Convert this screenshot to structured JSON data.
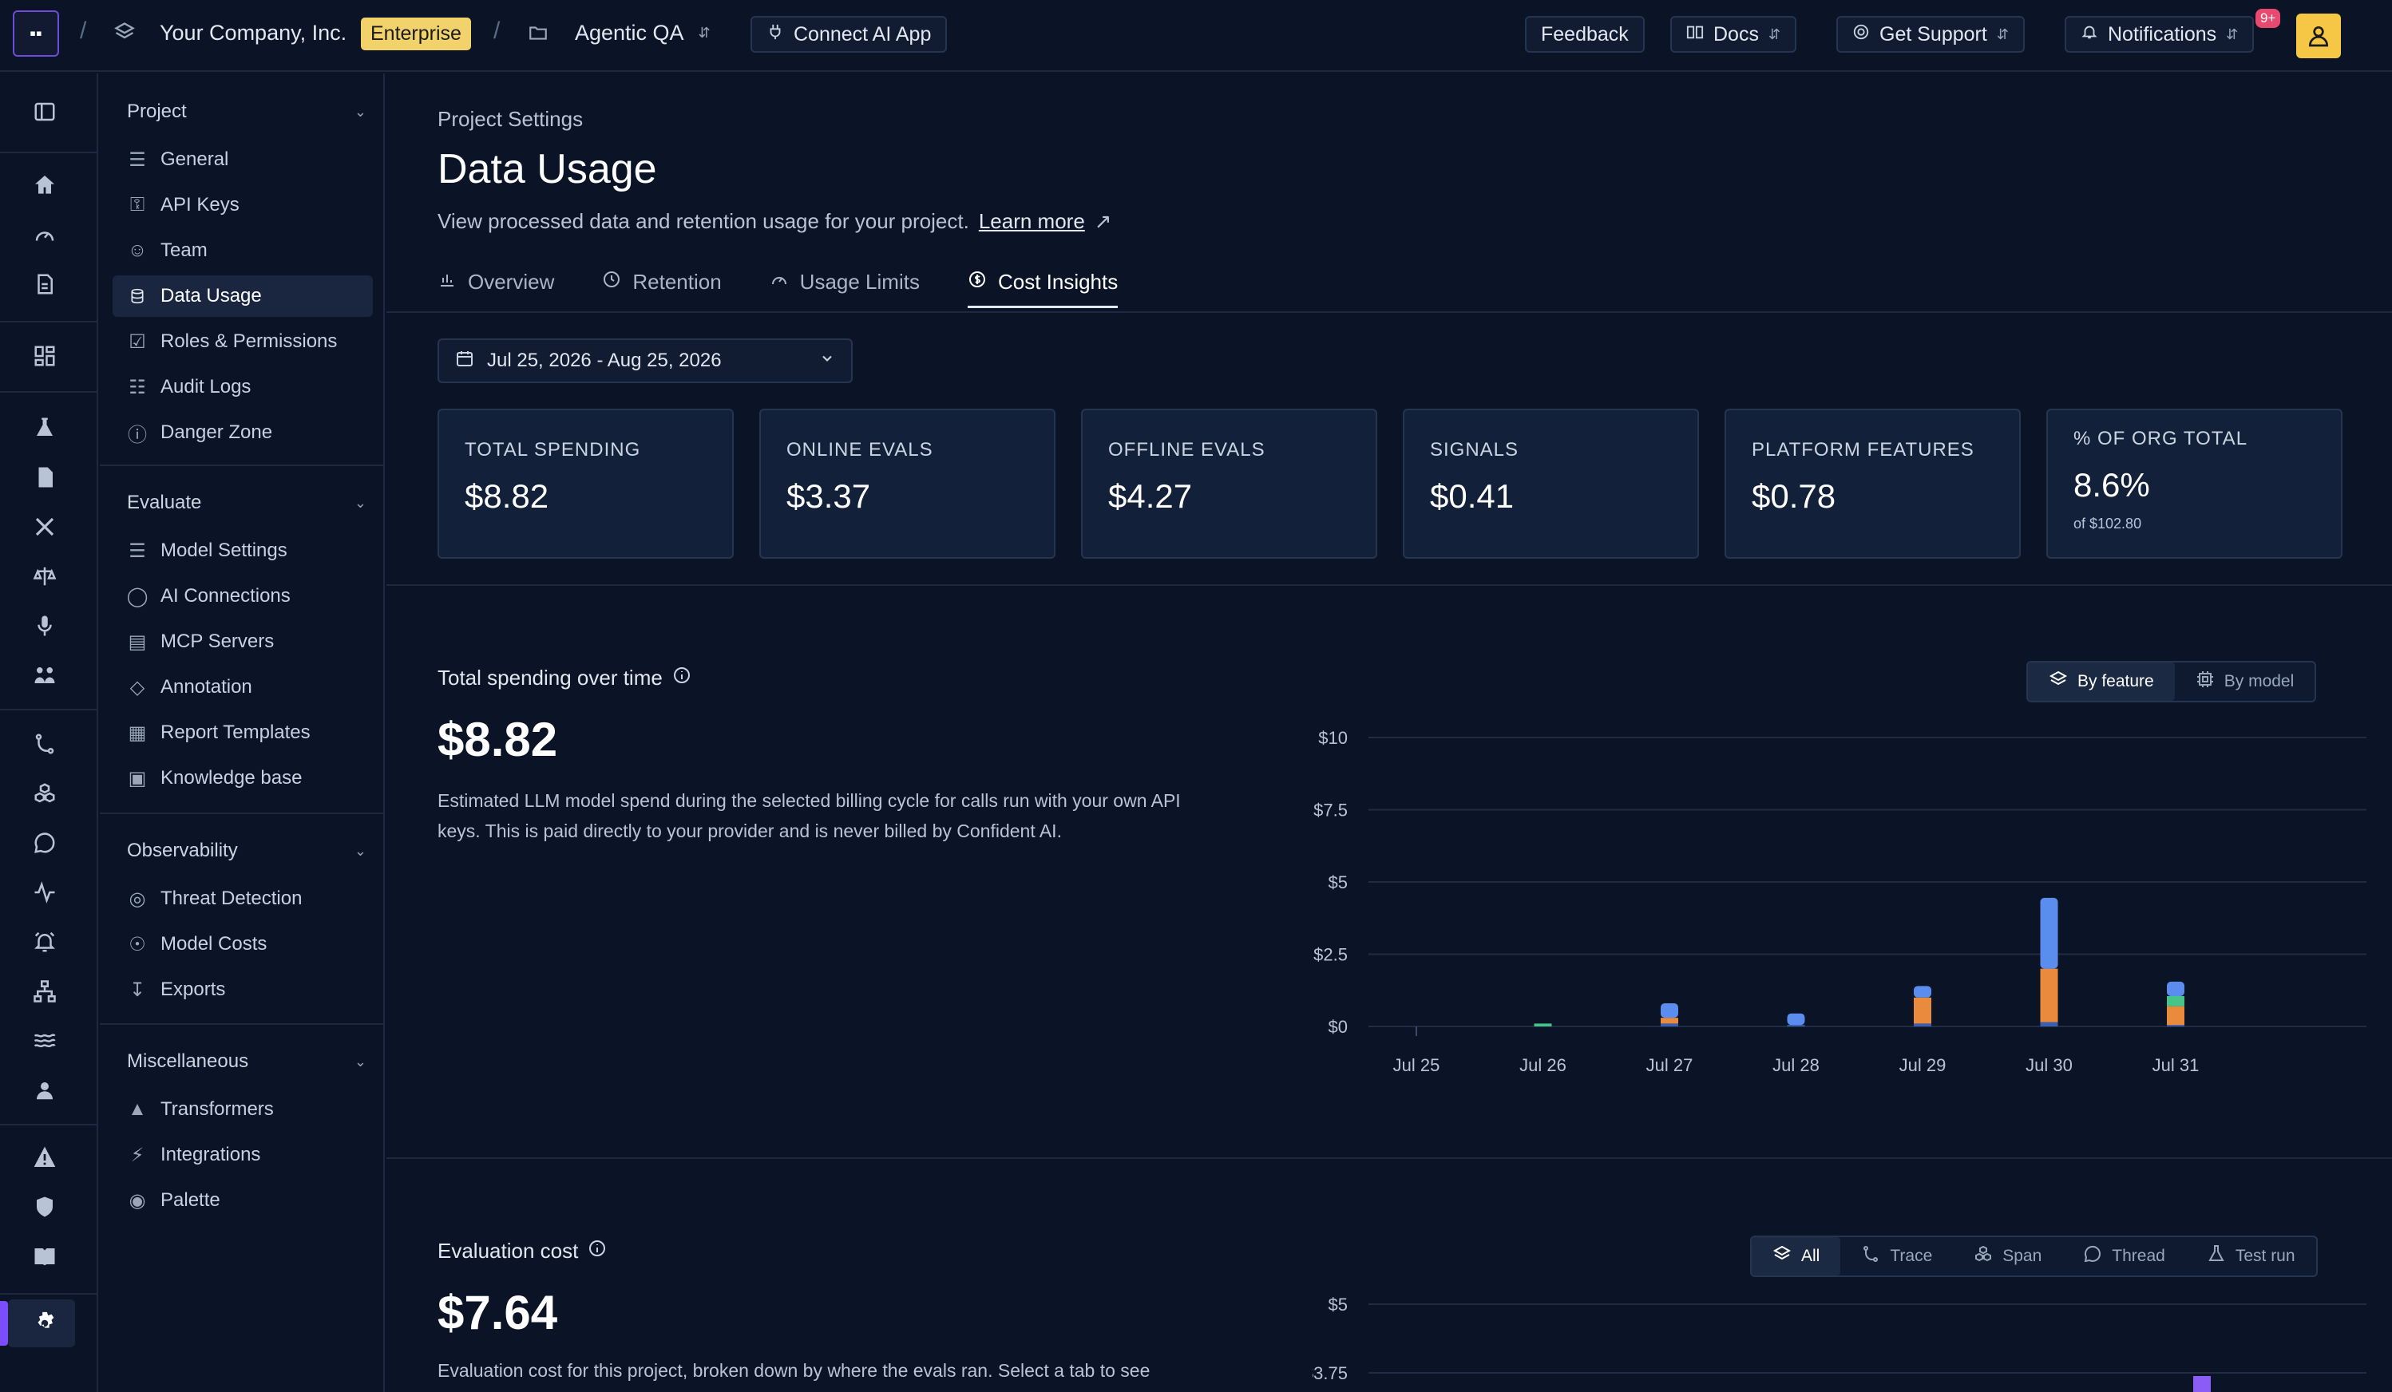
{
  "topbar": {
    "logo": "▪▪",
    "company": "Your Company, Inc.",
    "plan_badge": "Enterprise",
    "project": "Agentic QA",
    "connect_label": "Connect AI App",
    "feedback_label": "Feedback",
    "docs_label": "Docs",
    "support_label": "Get Support",
    "notifications_label": "Notifications",
    "notifications_badge": "9+"
  },
  "sidebar": {
    "groups": [
      {
        "title": "Project",
        "items": [
          "General",
          "API Keys",
          "Team",
          "Data Usage",
          "Roles & Permissions",
          "Audit Logs",
          "Danger Zone"
        ]
      },
      {
        "title": "Evaluate",
        "items": [
          "Model Settings",
          "AI Connections",
          "MCP Servers",
          "Annotation",
          "Report Templates",
          "Knowledge base"
        ]
      },
      {
        "title": "Observability",
        "items": [
          "Threat Detection",
          "Model Costs",
          "Exports"
        ]
      },
      {
        "title": "Miscellaneous",
        "items": [
          "Transformers",
          "Integrations",
          "Palette"
        ]
      }
    ],
    "active_item": "Data Usage"
  },
  "page": {
    "breadcrumb": "Project Settings",
    "title": "Data Usage",
    "description": "View processed data and retention usage for your project.",
    "learn_more": "Learn more",
    "tabs": [
      "Overview",
      "Retention",
      "Usage Limits",
      "Cost Insights"
    ],
    "active_tab": "Cost Insights",
    "date_range": "Jul 25, 2026 - Aug 25, 2026"
  },
  "cards": [
    {
      "label": "TOTAL SPENDING",
      "value": "$8.82"
    },
    {
      "label": "ONLINE EVALS",
      "value": "$3.37"
    },
    {
      "label": "OFFLINE EVALS",
      "value": "$4.27"
    },
    {
      "label": "SIGNALS",
      "value": "$0.41"
    },
    {
      "label": "PLATFORM FEATURES",
      "value": "$0.78"
    },
    {
      "label": "% OF ORG TOTAL",
      "value": "8.6%",
      "sub": "of $102.80"
    }
  ],
  "spending": {
    "title": "Total spending over time",
    "total": "$8.82",
    "description": "Estimated LLM model spend during the selected billing cycle for calls run with your own API keys. This is paid directly to your provider and is never billed by Confident AI.",
    "toggle": [
      "By feature",
      "By model"
    ],
    "toggle_active": "By feature"
  },
  "evaluation": {
    "title": "Evaluation cost",
    "total": "$7.64",
    "description": "Evaluation cost for this project, broken down by where the evals ran. Select a tab to see",
    "tabs": [
      "All",
      "Trace",
      "Span",
      "Thread",
      "Test run"
    ],
    "tab_active": "All"
  },
  "colors": {
    "accent": "#7c4dff",
    "blue": "#5b8def",
    "orange": "#e98a3c",
    "green": "#46c48a",
    "purple": "#8b5cf6"
  },
  "chart_data": [
    {
      "type": "bar",
      "stacked": true,
      "categories": [
        "Jul 25",
        "Jul 26",
        "Jul 27",
        "Jul 28",
        "Jul 29",
        "Jul 30",
        "Jul 31"
      ],
      "series": [
        {
          "color": "#3b5fb0",
          "values": [
            0,
            0,
            0.1,
            0.05,
            0.1,
            0.15,
            0.05
          ]
        },
        {
          "color": "#e98a3c",
          "values": [
            0,
            0,
            0.2,
            0,
            0.9,
            1.85,
            0.65
          ]
        },
        {
          "color": "#46c48a",
          "values": [
            0,
            0.1,
            0,
            0,
            0,
            0,
            0.35
          ]
        },
        {
          "color": "#5b8def",
          "values": [
            0,
            0,
            0.5,
            0.4,
            0.4,
            2.45,
            0.5
          ]
        }
      ],
      "yticks": [
        "$0",
        "$2.5",
        "$5",
        "$7.5",
        "$10"
      ],
      "ylim": [
        0,
        10
      ]
    },
    {
      "type": "bar",
      "stacked": true,
      "ytick_labels": [
        "$5",
        "$3.75"
      ],
      "ylim": [
        0,
        5
      ]
    }
  ]
}
